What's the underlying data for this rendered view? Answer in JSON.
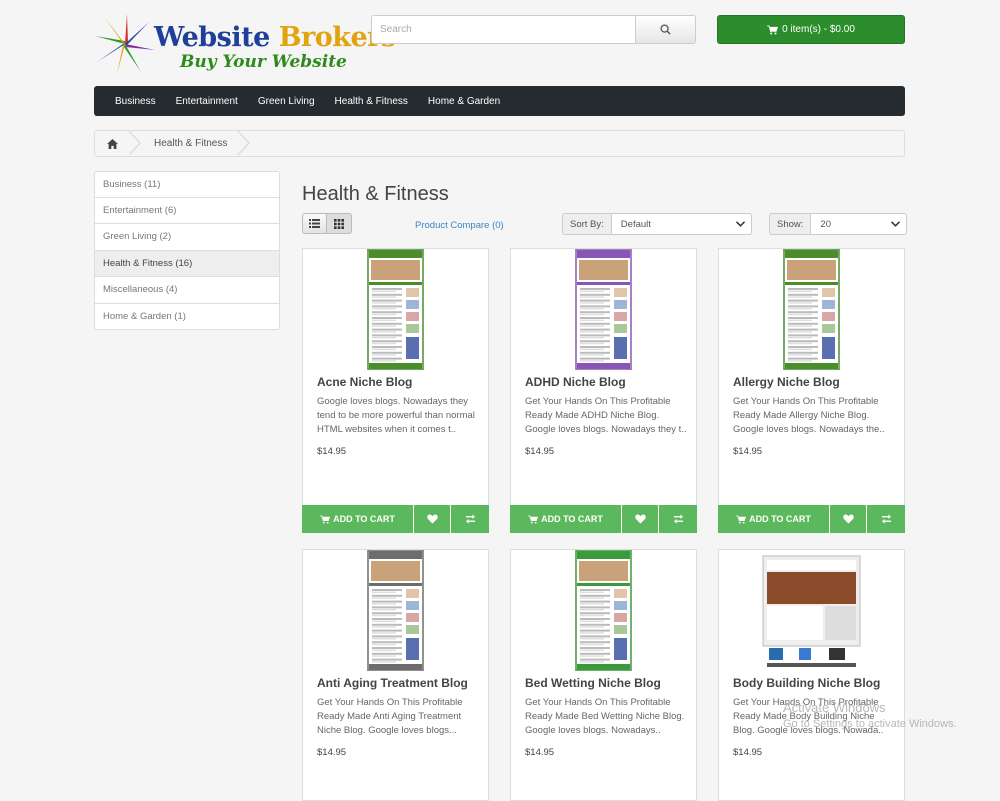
{
  "header": {
    "brand_part1": "Website",
    "brand_part2": "Brokers",
    "tagline": "Buy Your Website",
    "search_placeholder": "Search",
    "cart_label": "0 item(s) - $0.00"
  },
  "nav": {
    "items": [
      "Business",
      "Entertainment",
      "Green Living",
      "Health & Fitness",
      "Home & Garden"
    ]
  },
  "breadcrumb": {
    "current": "Health & Fitness"
  },
  "sidebar": {
    "categories": [
      {
        "label": "Business (11)",
        "active": false
      },
      {
        "label": "Entertainment (6)",
        "active": false
      },
      {
        "label": "Green Living (2)",
        "active": false
      },
      {
        "label": "Health & Fitness (16)",
        "active": true
      },
      {
        "label": "Miscellaneous (4)",
        "active": false
      },
      {
        "label": "Home & Garden (1)",
        "active": false
      }
    ]
  },
  "content": {
    "title": "Health & Fitness",
    "compare_link": "Product Compare (0)",
    "sort_label": "Sort By:",
    "sort_value": "Default",
    "show_label": "Show:",
    "show_value": "20"
  },
  "products": [
    {
      "name": "Acne Niche Blog",
      "desc": "Google loves blogs. Nowadays they tend to be more powerful than normal HTML websites when it comes t..",
      "price": "$14.95",
      "theme": "#4a8d2b"
    },
    {
      "name": "ADHD Niche Blog",
      "desc": "Get Your Hands On This Profitable Ready Made ADHD Niche Blog. Google loves blogs. Nowadays they t..",
      "price": "$14.95",
      "theme": "#8a56b5"
    },
    {
      "name": "Allergy Niche Blog",
      "desc": "Get Your Hands On This Profitable Ready Made Allergy Niche Blog. Google loves blogs. Nowadays the..",
      "price": "$14.95",
      "theme": "#4a8d2b"
    },
    {
      "name": "Anti Aging Treatment Blog",
      "desc": "Get Your Hands On This Profitable Ready Made Anti Aging Treatment Niche Blog. Google loves blogs...",
      "price": "$14.95",
      "theme": "#6d6d6d"
    },
    {
      "name": "Bed Wetting Niche Blog",
      "desc": "Get Your Hands On This Profitable Ready Made Bed Wetting Niche Blog. Google loves blogs. Nowadays..",
      "price": "$14.95",
      "theme": "#3b9a3b"
    },
    {
      "name": "Body Building Niche Blog",
      "desc": "Get Your Hands On This Profitable Ready Made Body Building Niche Blog. Google loves blogs. Nowada..",
      "price": "$14.95",
      "theme": "#8b4a2a"
    }
  ],
  "product_actions": {
    "add_to_cart": "ADD TO CART"
  },
  "os_watermark": {
    "line1": "Activate Windows",
    "line2": "Go to Settings to activate Windows."
  },
  "colors": {
    "accent_green": "#5cb85c",
    "cart_green": "#2c8d2c",
    "nav_dark": "#252b2f",
    "link_blue": "#3a85c6"
  }
}
